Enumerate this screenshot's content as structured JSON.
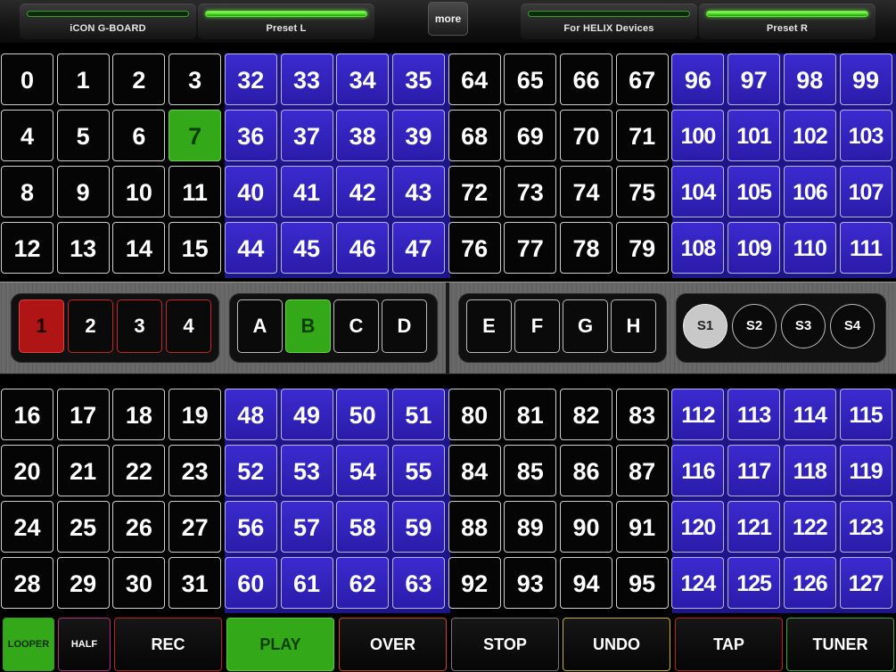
{
  "header": {
    "tabs": [
      {
        "label": "iCON G-BOARD",
        "on": false
      },
      {
        "label": "Preset L",
        "on": true
      },
      {
        "label": "For HELIX Devices",
        "on": false
      },
      {
        "label": "Preset R",
        "on": true
      }
    ],
    "more_label": "more"
  },
  "pads_top": [
    [
      "0",
      "1",
      "2",
      "3",
      "32",
      "33",
      "34",
      "35",
      "64",
      "65",
      "66",
      "67",
      "96",
      "97",
      "98",
      "99"
    ],
    [
      "4",
      "5",
      "6",
      "7",
      "36",
      "37",
      "38",
      "39",
      "68",
      "69",
      "70",
      "71",
      "100",
      "101",
      "102",
      "103"
    ],
    [
      "8",
      "9",
      "10",
      "11",
      "40",
      "41",
      "42",
      "43",
      "72",
      "73",
      "74",
      "75",
      "104",
      "105",
      "106",
      "107"
    ],
    [
      "12",
      "13",
      "14",
      "15",
      "44",
      "45",
      "46",
      "47",
      "76",
      "77",
      "78",
      "79",
      "108",
      "109",
      "110",
      "111"
    ]
  ],
  "pads_bottom": [
    [
      "16",
      "17",
      "18",
      "19",
      "48",
      "49",
      "50",
      "51",
      "80",
      "81",
      "82",
      "83",
      "112",
      "113",
      "114",
      "115"
    ],
    [
      "20",
      "21",
      "22",
      "23",
      "52",
      "53",
      "54",
      "55",
      "84",
      "85",
      "86",
      "87",
      "116",
      "117",
      "118",
      "119"
    ],
    [
      "24",
      "25",
      "26",
      "27",
      "56",
      "57",
      "58",
      "59",
      "88",
      "89",
      "90",
      "91",
      "120",
      "121",
      "122",
      "123"
    ],
    [
      "28",
      "29",
      "30",
      "31",
      "60",
      "61",
      "62",
      "63",
      "92",
      "93",
      "94",
      "95",
      "124",
      "125",
      "126",
      "127"
    ]
  ],
  "selected_pad": "7",
  "banks": [
    "1",
    "2",
    "3",
    "4"
  ],
  "selected_bank": "1",
  "letters_left": [
    "A",
    "B",
    "C",
    "D"
  ],
  "selected_letter": "B",
  "letters_right": [
    "E",
    "F",
    "G",
    "H"
  ],
  "snapshots": [
    "S1",
    "S2",
    "S3",
    "S4"
  ],
  "selected_snapshot": "S1",
  "bottom_buttons": [
    {
      "label": "LOOPER",
      "border": "#3a9a22",
      "bg": "#33a91a",
      "color": "#0b2a04",
      "size": 11
    },
    {
      "label": "HALF",
      "border": "#b0307a",
      "bg": "",
      "color": "#ffffff",
      "size": 11
    },
    {
      "label": "REC",
      "border": "#c02020",
      "bg": "",
      "color": "#ffffff",
      "size": 18
    },
    {
      "label": "PLAY",
      "border": "#4fd030",
      "bg": "#33a91a",
      "color": "#0e3d05",
      "size": 18
    },
    {
      "label": "OVER",
      "border": "#c84a18",
      "bg": "",
      "color": "#ffffff",
      "size": 18
    },
    {
      "label": "STOP",
      "border": "#777777",
      "bg": "",
      "color": "#ffffff",
      "size": 18
    },
    {
      "label": "UNDO",
      "border": "#c8b420",
      "bg": "",
      "color": "#ffffff",
      "size": 18
    },
    {
      "label": "TAP",
      "border": "#c02020",
      "bg": "",
      "color": "#ffffff",
      "size": 18
    },
    {
      "label": "TUNER",
      "border": "#3aaa30",
      "bg": "",
      "color": "#ffffff",
      "size": 18
    }
  ],
  "colors": {
    "pad_blue": "#2a1ca9",
    "active_green": "#33a91a",
    "bank_red": "#b01515"
  }
}
